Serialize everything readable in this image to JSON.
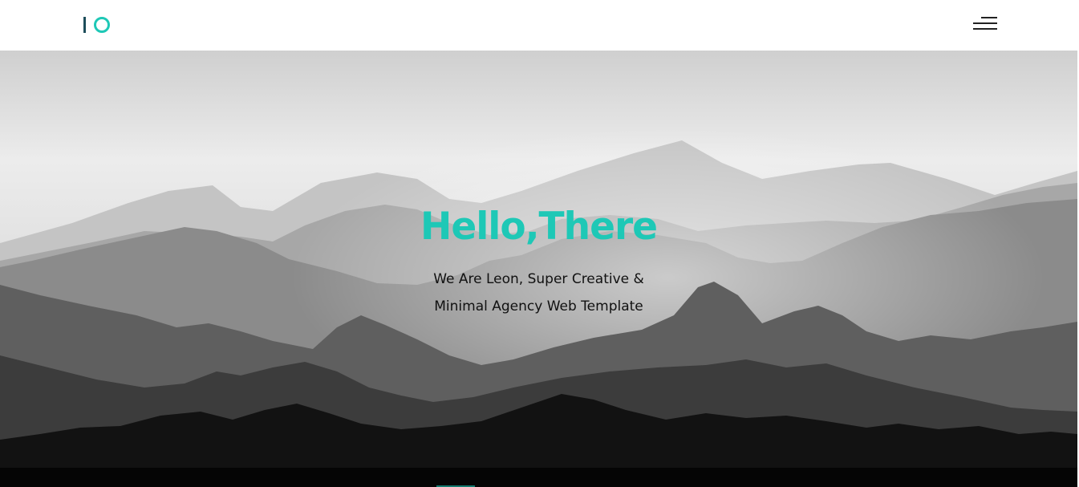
{
  "header": {
    "logo_icon": "io-logo",
    "menu_icon": "hamburger-menu-icon"
  },
  "hero": {
    "title": "Hello,There",
    "subtitle_line1": "We Are Leon, Super Creative &",
    "subtitle_line2": "Minimal Agency Web Template",
    "background": "grayscale-mountain-ranges-image"
  },
  "colors": {
    "accent": "#1ec8b6",
    "logo_bar": "#1d4d5a",
    "text_dark": "#111111",
    "header_bg": "#ffffff"
  }
}
